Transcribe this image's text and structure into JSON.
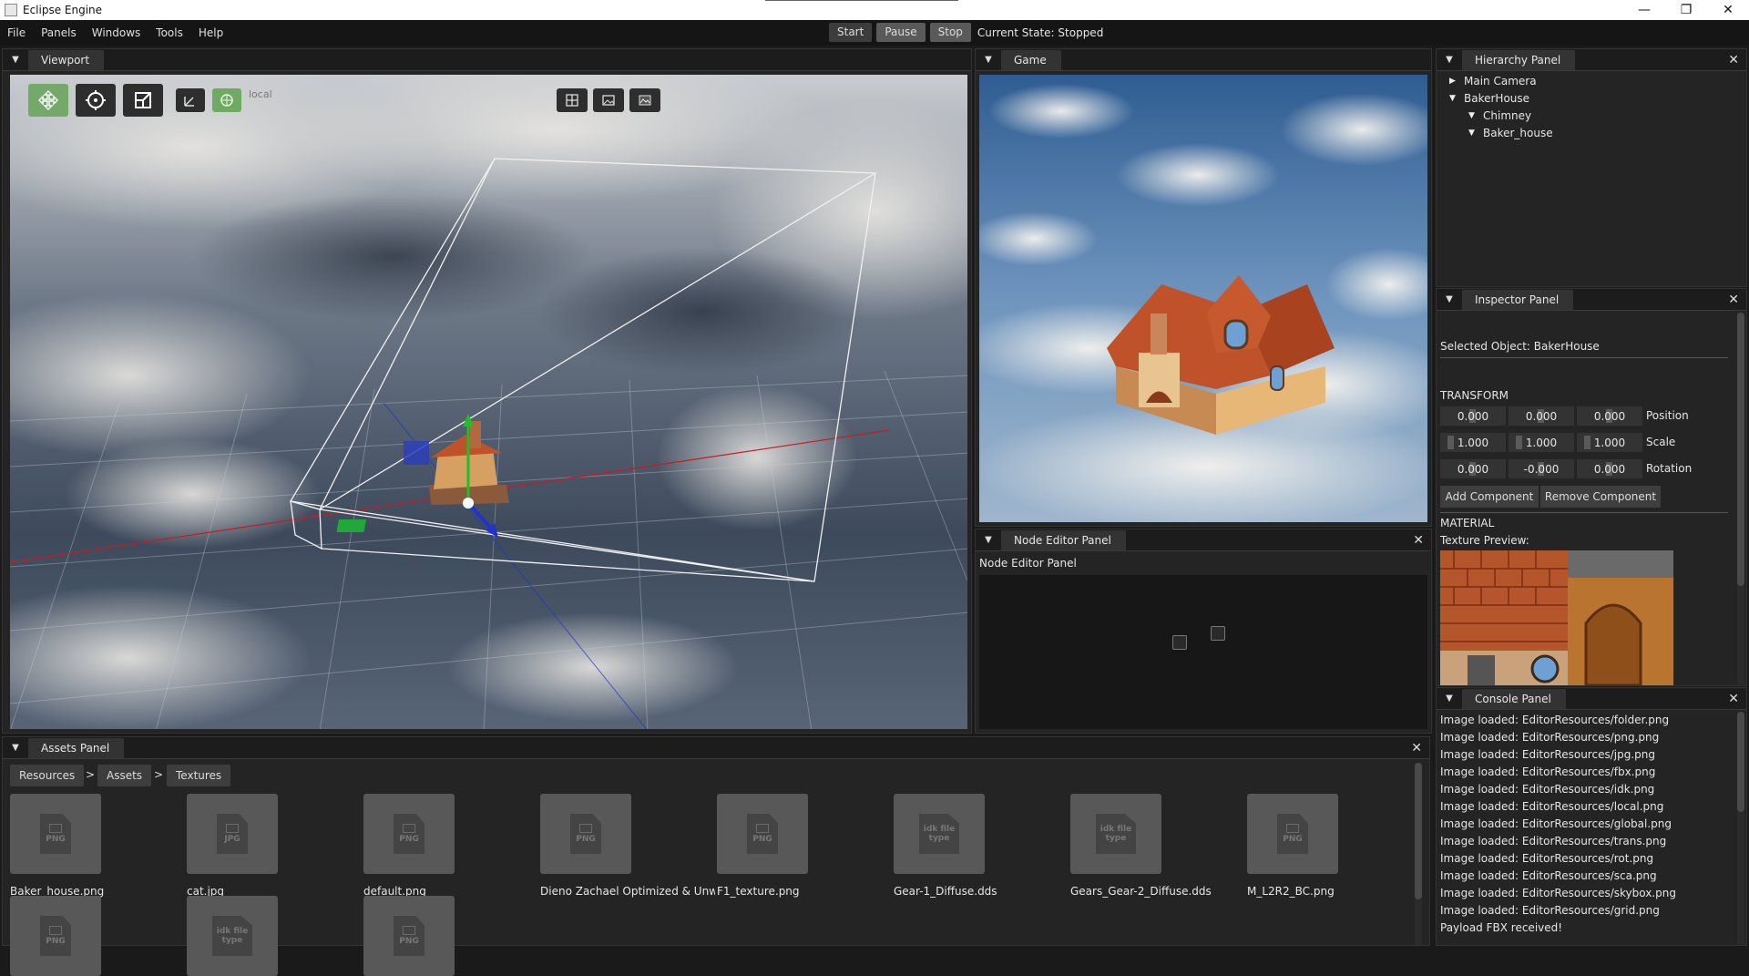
{
  "window": {
    "title": "Eclipse Engine",
    "controls": [
      "—",
      "❐",
      "✕"
    ]
  },
  "menu": [
    "File",
    "Panels",
    "Windows",
    "Tools",
    "Help"
  ],
  "play_controls": {
    "start": "Start",
    "pause": "Pause",
    "stop": "Stop",
    "state": "Current State: Stopped"
  },
  "viewport": {
    "tab": "Viewport",
    "mode_label": "local",
    "tools": [
      "move-gizmo-icon",
      "rotate-gizmo-icon",
      "scale-gizmo-icon",
      "local-space-icon",
      "global-space-icon"
    ],
    "view_buttons": [
      "grid-icon",
      "image-icon",
      "skybox-icon"
    ]
  },
  "game": {
    "tab": "Game"
  },
  "node_editor": {
    "tab": "Node Editor Panel",
    "title": "Node Editor Panel"
  },
  "hierarchy": {
    "tab": "Hierarchy Panel",
    "items": [
      {
        "label": "Main Camera",
        "arrow": "▶"
      },
      {
        "label": "BakerHouse",
        "arrow": "▼"
      },
      {
        "label": "Chimney",
        "arrow": "▼"
      },
      {
        "label": "Baker_house",
        "arrow": "▼"
      }
    ]
  },
  "inspector": {
    "tab": "Inspector Panel",
    "selected": "Selected Object: BakerHouse",
    "transform_header": "TRANSFORM",
    "position": [
      "0.000",
      "0.000",
      "0.000"
    ],
    "position_label": "Position",
    "scale": [
      "1.000",
      "1.000",
      "1.000"
    ],
    "scale_label": "Scale",
    "rotation": [
      "0.000",
      "-0.000",
      "0.000"
    ],
    "rotation_label": "Rotation",
    "add_component": "Add Component",
    "remove_component": "Remove Component",
    "material_header": "MATERIAL",
    "texture_preview": "Texture Preview:"
  },
  "console": {
    "tab": "Console Panel",
    "lines": [
      "Image loaded: EditorResources/folder.png",
      "Image loaded: EditorResources/png.png",
      "Image loaded: EditorResources/jpg.png",
      "Image loaded: EditorResources/fbx.png",
      "Image loaded: EditorResources/idk.png",
      "Image loaded: EditorResources/local.png",
      "Image loaded: EditorResources/global.png",
      "Image loaded: EditorResources/trans.png",
      "Image loaded: EditorResources/rot.png",
      "Image loaded: EditorResources/sca.png",
      "Image loaded: EditorResources/skybox.png",
      "Image loaded: EditorResources/grid.png",
      "Payload FBX received!"
    ]
  },
  "assets": {
    "tab": "Assets Panel",
    "breadcrumb": [
      "Resources",
      "Assets",
      "Textures"
    ],
    "separator": ">",
    "files": [
      {
        "name": "Baker_house.png",
        "ext": "PNG"
      },
      {
        "name": "cat.jpg",
        "ext": "JPG"
      },
      {
        "name": "default.png",
        "ext": "PNG"
      },
      {
        "name": "Dieno Zachael Optimized & Unwrap",
        "ext": "PNG"
      },
      {
        "name": "F1_texture.png",
        "ext": "PNG"
      },
      {
        "name": "Gear-1_Diffuse.dds",
        "ext": "idk file type"
      },
      {
        "name": "Gears_Gear-2_Diffuse.dds",
        "ext": "idk file type"
      },
      {
        "name": "M_L2R2_BC.png",
        "ext": "PNG"
      }
    ],
    "second_row": [
      {
        "ext": "PNG"
      },
      {
        "ext": "idk file type"
      },
      {
        "ext": "PNG"
      }
    ]
  },
  "colors": {
    "accent_green": "#74a96a",
    "panel_bg": "#242424",
    "tab_bg": "#333333",
    "axis_red": "#cc1a1a",
    "axis_green": "#1fbf2a",
    "axis_blue": "#2233cc"
  }
}
